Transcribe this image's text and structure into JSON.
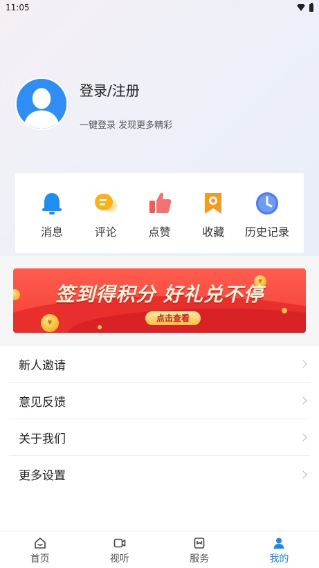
{
  "status_bar": {
    "time": "11:05"
  },
  "profile": {
    "title": "登录/注册",
    "subtitle": "一键登录 发现更多精彩"
  },
  "actions": [
    {
      "label": "消息",
      "icon": "bell-icon"
    },
    {
      "label": "评论",
      "icon": "comment-icon"
    },
    {
      "label": "点赞",
      "icon": "thumbs-up-icon"
    },
    {
      "label": "收藏",
      "icon": "bookmark-icon"
    },
    {
      "label": "历史记录",
      "icon": "clock-icon"
    }
  ],
  "banner": {
    "title": "签到得积分 好礼兑不停",
    "button": "点击查看",
    "coin_symbol": "¥"
  },
  "menu": [
    {
      "label": "新人邀请"
    },
    {
      "label": "意见反馈"
    },
    {
      "label": "关于我们"
    },
    {
      "label": "更多设置"
    }
  ],
  "bottom_nav": [
    {
      "label": "首页",
      "icon": "home-icon",
      "active": false
    },
    {
      "label": "视听",
      "icon": "video-icon",
      "active": false
    },
    {
      "label": "服务",
      "icon": "service-icon",
      "active": false
    },
    {
      "label": "我的",
      "icon": "user-icon",
      "active": true
    }
  ],
  "colors": {
    "accent": "#1e86f0",
    "avatar_bg": "#2f8ef3",
    "banner_red": "#f33d35",
    "bell": "#1e8ef2",
    "comment": "#f7b318",
    "thumbs": "#f25a5a",
    "bookmark": "#f59a1e",
    "clock": "#4a7cf0"
  }
}
